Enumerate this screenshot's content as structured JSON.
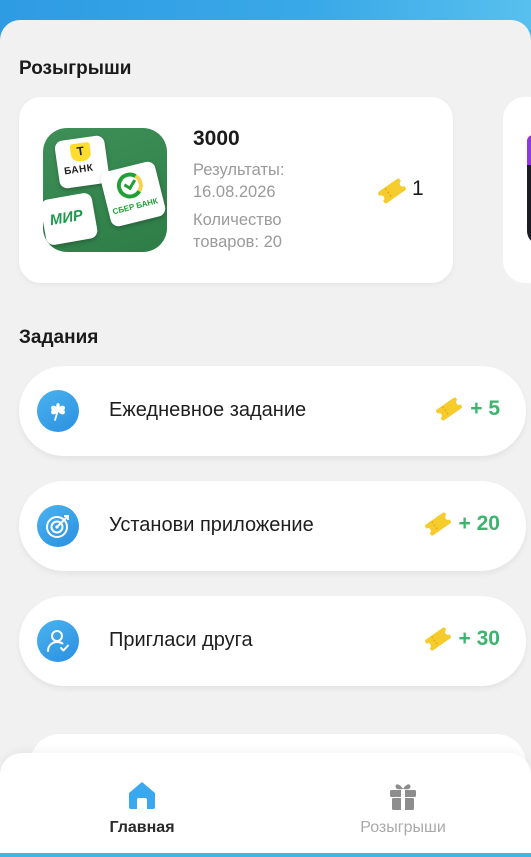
{
  "colors": {
    "accent": "#2f9fe6",
    "reward_green": "#3cb46e",
    "ticket_yellow": "#f6cc2c"
  },
  "raffles": {
    "title": "Розыгрыши",
    "card": {
      "amount": "3000",
      "results_label": "Результаты:",
      "results_date": "16.08.2026",
      "quantity_label": "Количество",
      "quantity_value": "товаров: 20",
      "ticket_count": "1",
      "logos": {
        "tbank": "БАНК",
        "tbank_mark": "Т",
        "mir": "МИР",
        "sber": "СБЕР БАНК"
      }
    }
  },
  "tasks": {
    "title": "Задания",
    "items": [
      {
        "label": "Ежедневное задание",
        "reward": "+ 5",
        "icon": "clover-icon"
      },
      {
        "label": "Установи приложение",
        "reward": "+ 20",
        "icon": "target-icon"
      },
      {
        "label": "Пригласи друга",
        "reward": "+ 30",
        "icon": "user-check-icon"
      }
    ]
  },
  "nav": {
    "home_label": "Главная",
    "raffles_label": "Розыгрыши",
    "active": "home"
  }
}
